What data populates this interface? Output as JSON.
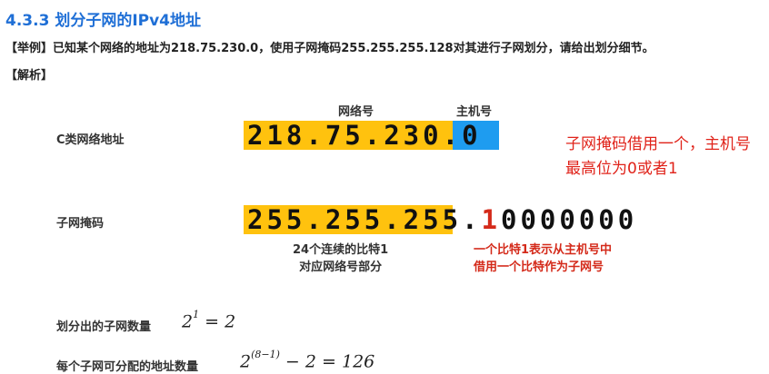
{
  "heading": {
    "title": "4.3.3 划分子网的IPv4地址"
  },
  "example": "【举例】已知某个网络的地址为218.75.230.0，使用子网掩码255.255.255.128对其进行子网划分，请给出划分细节。",
  "analysis_label": "【解析】",
  "diagram": {
    "header_net": "网络号",
    "header_host": "主机号",
    "row1_label": "C类网络地址",
    "ip_net_part": "218.75.230",
    "ip_host_part": ".0",
    "row2_label": "子网掩码",
    "mask_net_part": "255.255.255",
    "mask_dot": ".",
    "mask_borrowed_bit": "1",
    "mask_rest": "0000000",
    "note_left_1": "24个连续的比特1",
    "note_left_2": "对应网络号部分",
    "note_red_1": "一个比特1表示从主机号中",
    "note_red_2": "借用一个比特作为子网号",
    "side_note": "子网掩码借用一个，主机号最高位为0或者1",
    "colors": {
      "net_box": "#ffc20e",
      "host_box": "#1e9cf0",
      "red": "#d42a1a"
    }
  },
  "calc": {
    "subnets_label": "划分出的子网数量",
    "subnets_base": "2",
    "subnets_exp": "1",
    "subnets_rest": " = 2",
    "hosts_label": "每个子网可分配的地址数量",
    "hosts_base": "2",
    "hosts_exp": "(8−1)",
    "hosts_rest": " − 2 = 126"
  }
}
